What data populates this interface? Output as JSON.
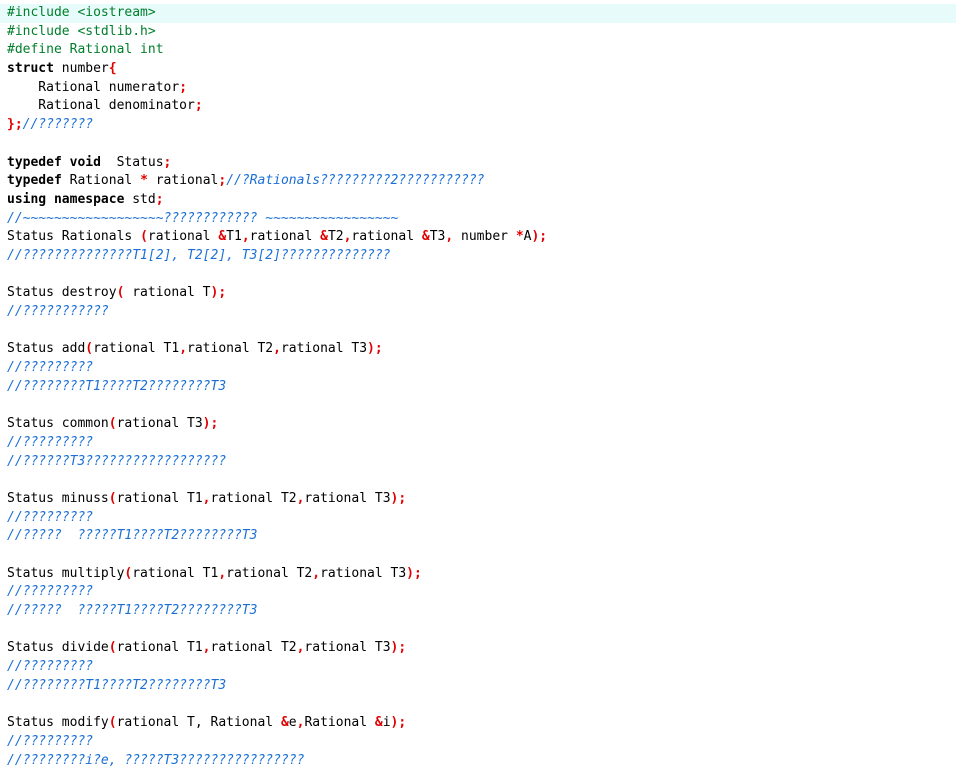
{
  "editor": {
    "lines": [
      [
        {
          "t": "pp",
          "v": "#include <iostream>"
        }
      ],
      [
        {
          "t": "pp",
          "v": "#include <stdlib.h>"
        }
      ],
      [
        {
          "t": "pp",
          "v": "#define Rational int"
        }
      ],
      [
        {
          "t": "kw",
          "v": "struct"
        },
        {
          "t": "id",
          "v": " number"
        },
        {
          "t": "op",
          "v": "{"
        }
      ],
      [
        {
          "t": "id",
          "v": "    Rational numerator"
        },
        {
          "t": "op",
          "v": ";"
        }
      ],
      [
        {
          "t": "id",
          "v": "    Rational denominator"
        },
        {
          "t": "op",
          "v": ";"
        }
      ],
      [
        {
          "t": "op",
          "v": "};"
        },
        {
          "t": "cm",
          "v": "//???????"
        }
      ],
      [],
      [
        {
          "t": "kw",
          "v": "typedef void"
        },
        {
          "t": "id",
          "v": "  Status"
        },
        {
          "t": "op",
          "v": ";"
        }
      ],
      [
        {
          "t": "kw",
          "v": "typedef"
        },
        {
          "t": "id",
          "v": " Rational "
        },
        {
          "t": "op",
          "v": "*"
        },
        {
          "t": "id",
          "v": " rational"
        },
        {
          "t": "op",
          "v": ";"
        },
        {
          "t": "cm",
          "v": "//?Rationals?????????2???????????"
        }
      ],
      [
        {
          "t": "kw",
          "v": "using namespace"
        },
        {
          "t": "id",
          "v": " std"
        },
        {
          "t": "op",
          "v": ";"
        }
      ],
      [
        {
          "t": "cm",
          "v": "//~~~~~~~~~~~~~~~~~~???????????? ~~~~~~~~~~~~~~~~~"
        }
      ],
      [
        {
          "t": "id",
          "v": "Status Rationals "
        },
        {
          "t": "op",
          "v": "("
        },
        {
          "t": "id",
          "v": "rational "
        },
        {
          "t": "op",
          "v": "&"
        },
        {
          "t": "id",
          "v": "T1"
        },
        {
          "t": "op",
          "v": ","
        },
        {
          "t": "id",
          "v": "rational "
        },
        {
          "t": "op",
          "v": "&"
        },
        {
          "t": "id",
          "v": "T2"
        },
        {
          "t": "op",
          "v": ","
        },
        {
          "t": "id",
          "v": "rational "
        },
        {
          "t": "op",
          "v": "&"
        },
        {
          "t": "id",
          "v": "T3"
        },
        {
          "t": "op",
          "v": ","
        },
        {
          "t": "id",
          "v": " number "
        },
        {
          "t": "op",
          "v": "*"
        },
        {
          "t": "id",
          "v": "A"
        },
        {
          "t": "op",
          "v": ");"
        }
      ],
      [
        {
          "t": "cm",
          "v": "//??????????????T1[2], T2[2], T3[2]??????????????"
        }
      ],
      [],
      [
        {
          "t": "id",
          "v": "Status destroy"
        },
        {
          "t": "op",
          "v": "("
        },
        {
          "t": "id",
          "v": " rational T"
        },
        {
          "t": "op",
          "v": ");"
        }
      ],
      [
        {
          "t": "cm",
          "v": "//???????????"
        }
      ],
      [],
      [
        {
          "t": "id",
          "v": "Status add"
        },
        {
          "t": "op",
          "v": "("
        },
        {
          "t": "id",
          "v": "rational T1"
        },
        {
          "t": "op",
          "v": ","
        },
        {
          "t": "id",
          "v": "rational T2"
        },
        {
          "t": "op",
          "v": ","
        },
        {
          "t": "id",
          "v": "rational T3"
        },
        {
          "t": "op",
          "v": ");"
        }
      ],
      [
        {
          "t": "cm",
          "v": "//?????????"
        }
      ],
      [
        {
          "t": "cm",
          "v": "//????????T1????T2????????T3"
        }
      ],
      [],
      [
        {
          "t": "id",
          "v": "Status common"
        },
        {
          "t": "op",
          "v": "("
        },
        {
          "t": "id",
          "v": "rational T3"
        },
        {
          "t": "op",
          "v": ");"
        }
      ],
      [
        {
          "t": "cm",
          "v": "//?????????"
        }
      ],
      [
        {
          "t": "cm",
          "v": "//??????T3??????????????????"
        }
      ],
      [],
      [
        {
          "t": "id",
          "v": "Status minuss"
        },
        {
          "t": "op",
          "v": "("
        },
        {
          "t": "id",
          "v": "rational T1"
        },
        {
          "t": "op",
          "v": ","
        },
        {
          "t": "id",
          "v": "rational T2"
        },
        {
          "t": "op",
          "v": ","
        },
        {
          "t": "id",
          "v": "rational T3"
        },
        {
          "t": "op",
          "v": ");"
        }
      ],
      [
        {
          "t": "cm",
          "v": "//?????????"
        }
      ],
      [
        {
          "t": "cm",
          "v": "//?????  ?????T1????T2????????T3"
        }
      ],
      [],
      [
        {
          "t": "id",
          "v": "Status multiply"
        },
        {
          "t": "op",
          "v": "("
        },
        {
          "t": "id",
          "v": "rational T1"
        },
        {
          "t": "op",
          "v": ","
        },
        {
          "t": "id",
          "v": "rational T2"
        },
        {
          "t": "op",
          "v": ","
        },
        {
          "t": "id",
          "v": "rational T3"
        },
        {
          "t": "op",
          "v": ");"
        }
      ],
      [
        {
          "t": "cm",
          "v": "//?????????"
        }
      ],
      [
        {
          "t": "cm",
          "v": "//?????  ?????T1????T2????????T3"
        }
      ],
      [],
      [
        {
          "t": "id",
          "v": "Status divide"
        },
        {
          "t": "op",
          "v": "("
        },
        {
          "t": "id",
          "v": "rational T1"
        },
        {
          "t": "op",
          "v": ","
        },
        {
          "t": "id",
          "v": "rational T2"
        },
        {
          "t": "op",
          "v": ","
        },
        {
          "t": "id",
          "v": "rational T3"
        },
        {
          "t": "op",
          "v": ");"
        }
      ],
      [
        {
          "t": "cm",
          "v": "//?????????"
        }
      ],
      [
        {
          "t": "cm",
          "v": "//????????T1????T2????????T3"
        }
      ],
      [],
      [
        {
          "t": "id",
          "v": "Status modify"
        },
        {
          "t": "op",
          "v": "("
        },
        {
          "t": "id",
          "v": "rational T, Rational "
        },
        {
          "t": "op",
          "v": "&"
        },
        {
          "t": "id",
          "v": "e"
        },
        {
          "t": "op",
          "v": ","
        },
        {
          "t": "id",
          "v": "Rational "
        },
        {
          "t": "op",
          "v": "&"
        },
        {
          "t": "id",
          "v": "i"
        },
        {
          "t": "op",
          "v": ");"
        }
      ],
      [
        {
          "t": "cm",
          "v": "//?????????"
        }
      ],
      [
        {
          "t": "cm",
          "v": "//????????i?e, ?????T3????????????????"
        }
      ]
    ]
  }
}
